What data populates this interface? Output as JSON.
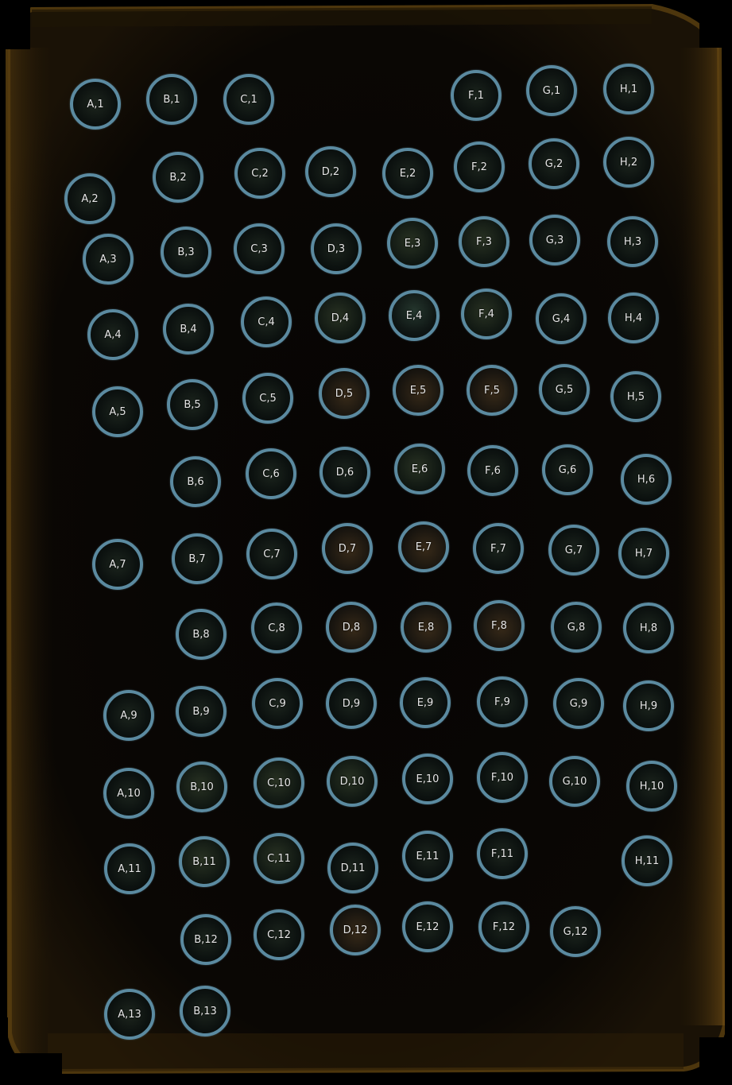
{
  "image": {
    "description_colors": {
      "background": "#000000",
      "slide_edge": "#6b4a12",
      "core_ring": "#5b8aa0",
      "label": "#e6e6e6"
    }
  },
  "cores": [
    {
      "label": "A,1"
    },
    {
      "label": "B,1"
    },
    {
      "label": "C,1"
    },
    {
      "label": "F,1"
    },
    {
      "label": "G,1"
    },
    {
      "label": "H,1"
    },
    {
      "label": "A,2"
    },
    {
      "label": "B,2"
    },
    {
      "label": "C,2"
    },
    {
      "label": "D,2"
    },
    {
      "label": "E,2"
    },
    {
      "label": "F,2"
    },
    {
      "label": "G,2"
    },
    {
      "label": "H,2"
    },
    {
      "label": "A,3"
    },
    {
      "label": "B,3"
    },
    {
      "label": "C,3"
    },
    {
      "label": "D,3"
    },
    {
      "label": "E,3"
    },
    {
      "label": "F,3"
    },
    {
      "label": "G,3"
    },
    {
      "label": "H,3"
    },
    {
      "label": "A,4"
    },
    {
      "label": "B,4"
    },
    {
      "label": "C,4"
    },
    {
      "label": "D,4"
    },
    {
      "label": "E,4"
    },
    {
      "label": "F,4"
    },
    {
      "label": "G,4"
    },
    {
      "label": "H,4"
    },
    {
      "label": "A,5"
    },
    {
      "label": "B,5"
    },
    {
      "label": "C,5"
    },
    {
      "label": "D,5"
    },
    {
      "label": "E,5"
    },
    {
      "label": "F,5"
    },
    {
      "label": "G,5"
    },
    {
      "label": "H,5"
    },
    {
      "label": "B,6"
    },
    {
      "label": "C,6"
    },
    {
      "label": "D,6"
    },
    {
      "label": "E,6"
    },
    {
      "label": "F,6"
    },
    {
      "label": "G,6"
    },
    {
      "label": "H,6"
    },
    {
      "label": "A,7"
    },
    {
      "label": "B,7"
    },
    {
      "label": "C,7"
    },
    {
      "label": "D,7"
    },
    {
      "label": "E,7"
    },
    {
      "label": "F,7"
    },
    {
      "label": "G,7"
    },
    {
      "label": "H,7"
    },
    {
      "label": "B,8"
    },
    {
      "label": "C,8"
    },
    {
      "label": "D,8"
    },
    {
      "label": "E,8"
    },
    {
      "label": "F,8"
    },
    {
      "label": "G,8"
    },
    {
      "label": "H,8"
    },
    {
      "label": "A,9"
    },
    {
      "label": "B,9"
    },
    {
      "label": "C,9"
    },
    {
      "label": "D,9"
    },
    {
      "label": "E,9"
    },
    {
      "label": "F,9"
    },
    {
      "label": "G,9"
    },
    {
      "label": "H,9"
    },
    {
      "label": "A,10"
    },
    {
      "label": "B,10"
    },
    {
      "label": "C,10"
    },
    {
      "label": "D,10"
    },
    {
      "label": "E,10"
    },
    {
      "label": "F,10"
    },
    {
      "label": "G,10"
    },
    {
      "label": "H,10"
    },
    {
      "label": "A,11"
    },
    {
      "label": "B,11"
    },
    {
      "label": "C,11"
    },
    {
      "label": "D,11"
    },
    {
      "label": "E,11"
    },
    {
      "label": "F,11"
    },
    {
      "label": "H,11"
    },
    {
      "label": "B,12"
    },
    {
      "label": "C,12"
    },
    {
      "label": "D,12"
    },
    {
      "label": "E,12"
    },
    {
      "label": "F,12"
    },
    {
      "label": "G,12"
    },
    {
      "label": "A,13"
    },
    {
      "label": "B,13"
    }
  ]
}
